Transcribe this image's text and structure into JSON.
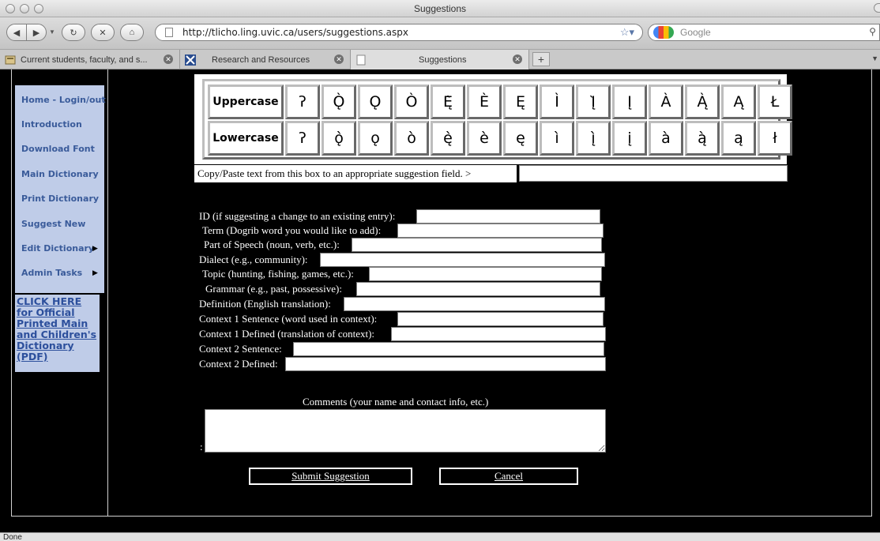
{
  "window": {
    "title": "Suggestions"
  },
  "toolbar": {
    "url": "http://tlicho.ling.uvic.ca/users/suggestions.aspx",
    "search_placeholder": "Google"
  },
  "tabs": [
    {
      "label": "Current students, faculty, and s..."
    },
    {
      "label": "Research and Resources"
    },
    {
      "label": "Suggestions"
    }
  ],
  "sidebar": {
    "items": [
      {
        "label": "Home - Login/out"
      },
      {
        "label": "Introduction"
      },
      {
        "label": "Download Font"
      },
      {
        "label": "Main Dictionary"
      },
      {
        "label": "Print Dictionary"
      },
      {
        "label": "Suggest New"
      },
      {
        "label": "Edit Dictionary"
      },
      {
        "label": "Admin Tasks"
      }
    ],
    "pdf_link": "CLICK HERE for Official Printed Main and Children's Dictionary (PDF)"
  },
  "char_table": {
    "upper_label": "Uppercase",
    "lower_label": "Lowercase",
    "upper": [
      "ʔ",
      "Ǫ̀",
      "Ǫ",
      "Ò",
      "Ę̀",
      "È",
      "Ę",
      "Ì",
      "Į̀",
      "Į",
      "À",
      "Ą̀",
      "Ą",
      "Ł"
    ],
    "lower": [
      "ʔ",
      "ǫ̀",
      "ǫ",
      "ò",
      "ę̀",
      "è",
      "ę",
      "ì",
      "į̀",
      "į",
      "à",
      "ą̀",
      "ą",
      "ł"
    ]
  },
  "copy": {
    "label": "Copy/Paste text from this box to an appropriate suggestion field. >"
  },
  "form": {
    "fields": [
      {
        "label": "ID (if suggesting a change to an existing entry):"
      },
      {
        "label": "Term (Dogrib word you would like to add):"
      },
      {
        "label": "Part of Speech (noun, verb, etc.):"
      },
      {
        "label": "Dialect (e.g., community):"
      },
      {
        "label": "Topic (hunting, fishing, games, etc.):"
      },
      {
        "label": "Grammar (e.g., past, possessive):"
      },
      {
        "label": "Definition (English translation):"
      },
      {
        "label": "Context 1 Sentence (word used in context):"
      },
      {
        "label": "Context 1 Defined (translation of context):"
      },
      {
        "label": "Context 2 Sentence:"
      },
      {
        "label": "Context 2 Defined:"
      }
    ],
    "comments_label": "Comments (your name and contact info, etc.)",
    "comments_colon": ":",
    "submit_label": "Submit Suggestion",
    "cancel_label": "Cancel"
  },
  "status": {
    "text": "Done"
  }
}
